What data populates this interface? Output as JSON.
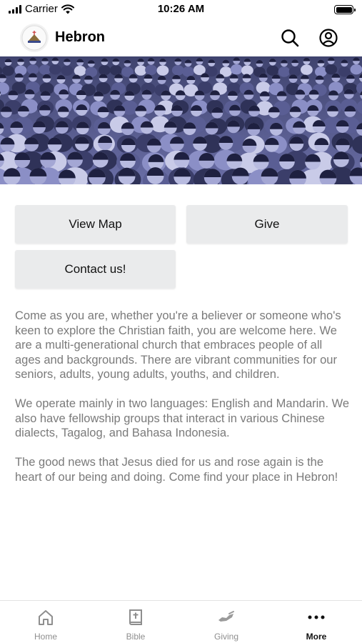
{
  "status_bar": {
    "carrier": "Carrier",
    "time": "10:26 AM"
  },
  "header": {
    "title": "Hebron",
    "logo_icon": "church-logo",
    "search_icon": "search-icon",
    "account_icon": "account-icon"
  },
  "hero": {
    "icon": "crowd-photo",
    "tint": "#4b4f80"
  },
  "buttons": {
    "view_map": "View Map",
    "give": "Give",
    "contact": "Contact us!"
  },
  "content": {
    "paragraphs": [
      "Come as you are, whether you're a believer or someone who's keen to explore the Christian faith, you are welcome here. We are a multi-generational church that embraces people of all ages and backgrounds. There are vibrant communities for our seniors, adults, young adults, youths, and children.",
      "We operate mainly in two languages: English and Mandarin. We also have fellowship groups that interact in various Chinese dialects, Tagalog, and Bahasa Indonesia.",
      "The good news that Jesus died for us and rose again is the heart of our being and doing. Come find your place in Hebron!"
    ]
  },
  "tab_bar": {
    "items": [
      {
        "label": "Home",
        "icon": "home-icon",
        "active": false
      },
      {
        "label": "Bible",
        "icon": "bible-icon",
        "active": false
      },
      {
        "label": "Giving",
        "icon": "giving-icon",
        "active": false
      },
      {
        "label": "More",
        "icon": "more-icon",
        "active": true
      }
    ]
  },
  "colors": {
    "text": "#7a7a7a",
    "button_bg": "#eaebec",
    "tab_inactive": "#8e8e8e",
    "tab_active": "#111111"
  }
}
